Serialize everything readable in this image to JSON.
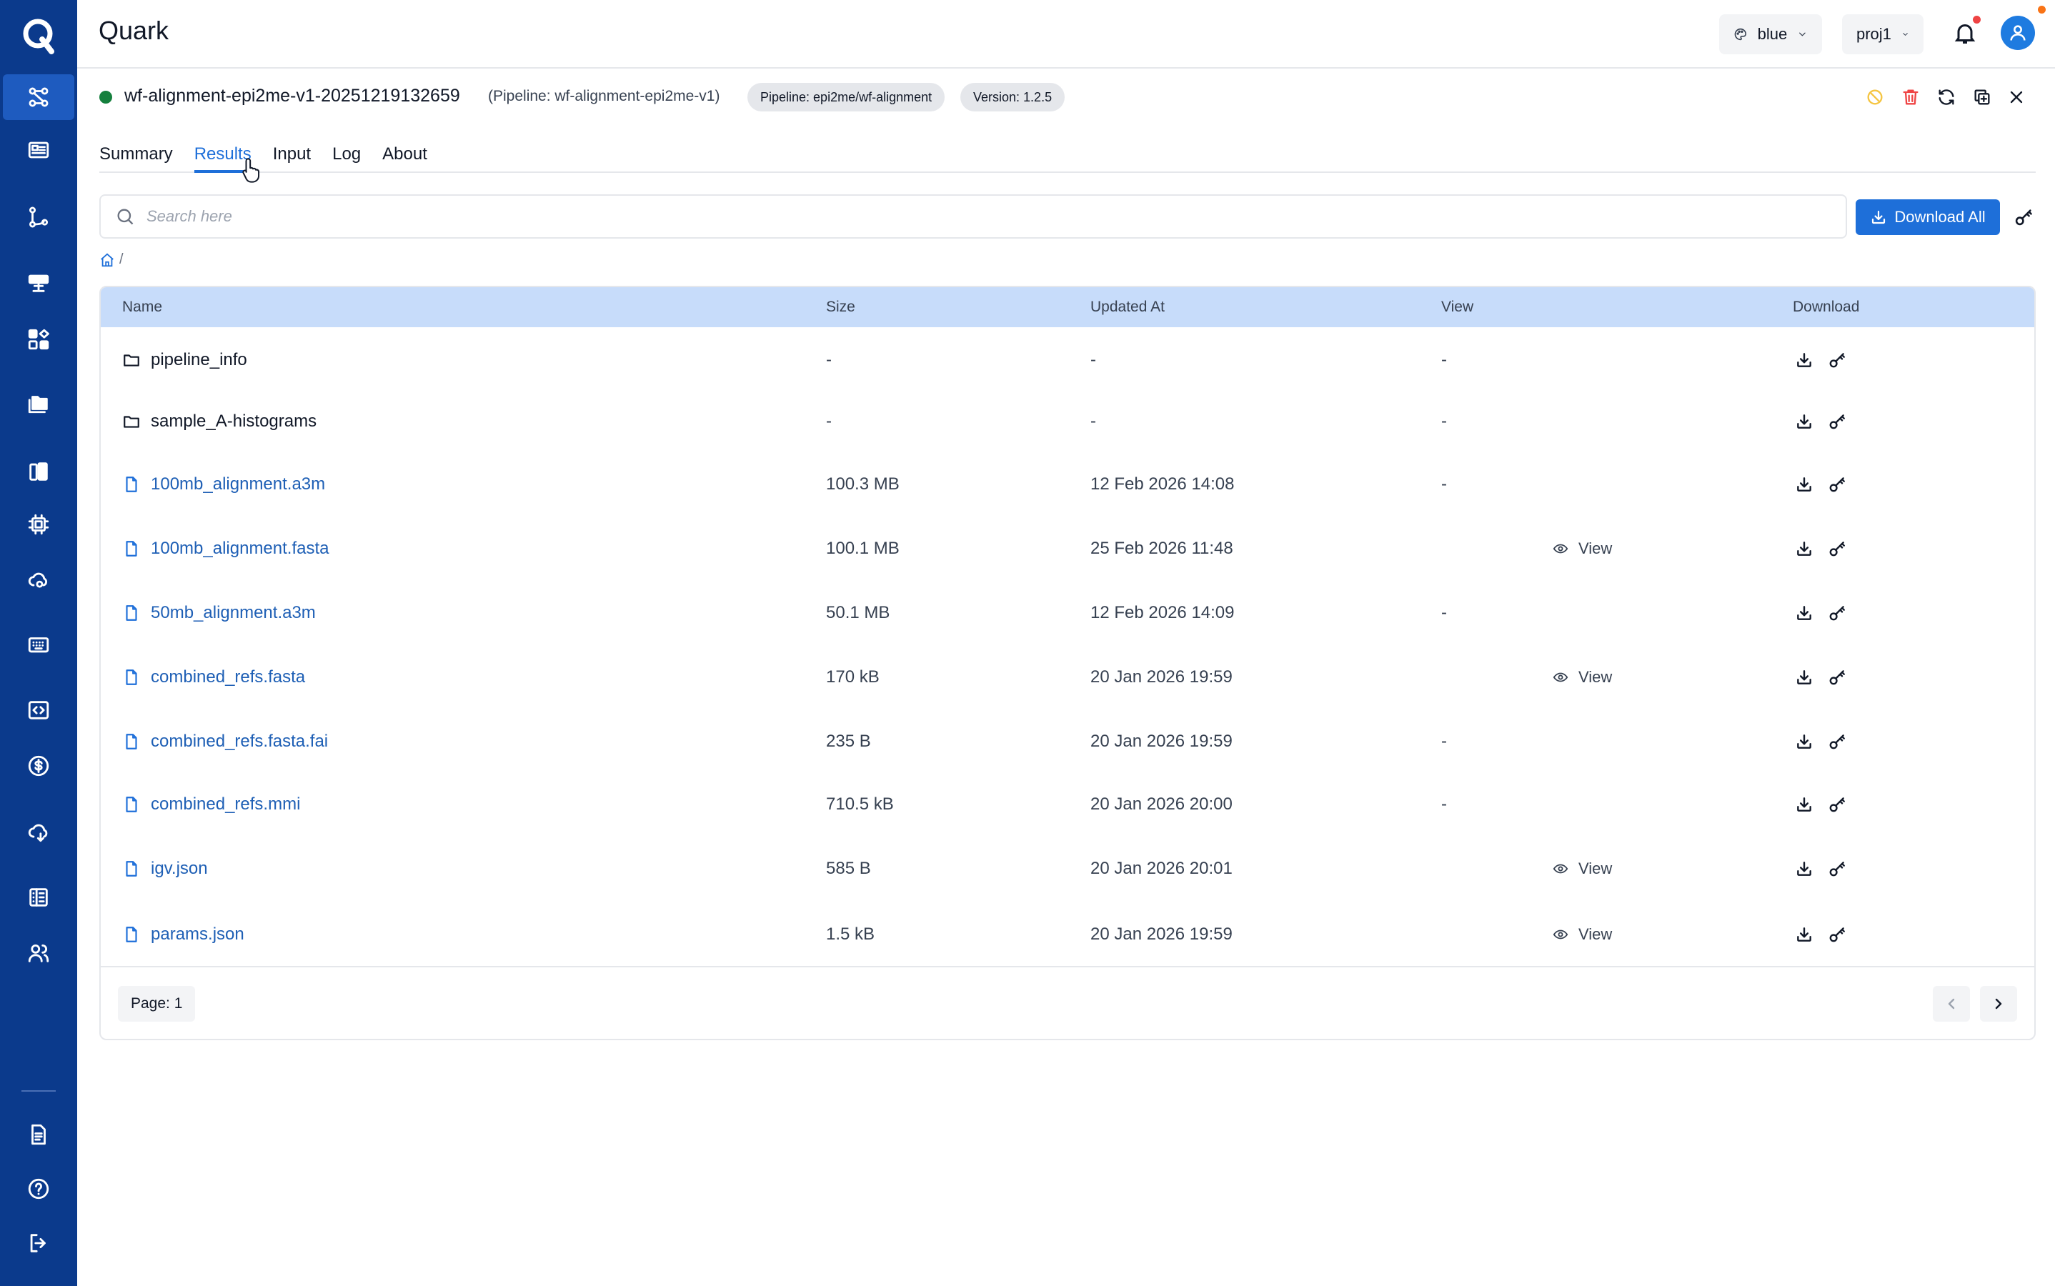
{
  "app": {
    "title": "Quark",
    "logo_letter": "Q"
  },
  "header": {
    "theme_label": "blue",
    "project_label": "proj1"
  },
  "colors": {
    "brand": "#0b3a8c",
    "accent": "#1e6fd9",
    "status_ok": "#15803d",
    "header_row": "#c7dcfa"
  },
  "sidebar": {
    "items": [
      {
        "icon": "workflow-icon"
      },
      {
        "icon": "id-card-icon"
      },
      {
        "icon": "pipeline-icon"
      },
      {
        "icon": "server-icon"
      },
      {
        "icon": "apps-icon"
      },
      {
        "icon": "folders-icon"
      },
      {
        "icon": "library-icon"
      },
      {
        "icon": "chip-icon"
      },
      {
        "icon": "cloud-settings-icon"
      },
      {
        "icon": "keyboard-icon"
      },
      {
        "icon": "code-icon"
      },
      {
        "icon": "billing-icon"
      },
      {
        "icon": "cloud-download-icon"
      },
      {
        "icon": "sheet-icon"
      },
      {
        "icon": "users-icon"
      },
      {
        "icon": "document-icon"
      },
      {
        "icon": "help-icon"
      },
      {
        "icon": "logout-icon"
      }
    ]
  },
  "run": {
    "name": "wf-alignment-epi2me-v1-20251219132659",
    "pipeline_paren": "(Pipeline: wf-alignment-epi2me-v1)",
    "pipeline_chip": "Pipeline: epi2me/wf-alignment",
    "version_chip": "Version: 1.2.5"
  },
  "tabs": [
    {
      "label": "Summary"
    },
    {
      "label": "Results"
    },
    {
      "label": "Input"
    },
    {
      "label": "Log"
    },
    {
      "label": "About"
    }
  ],
  "search": {
    "placeholder": "Search here",
    "value": ""
  },
  "download_all_label": "Download All",
  "breadcrumb": {
    "separator": "/"
  },
  "table": {
    "headers": {
      "name": "Name",
      "size": "Size",
      "updated": "Updated At",
      "view": "View",
      "download": "Download"
    },
    "rows": [
      {
        "type": "folder",
        "name": "pipeline_info",
        "size": "-",
        "updated": "-",
        "view": "-"
      },
      {
        "type": "folder",
        "name": "sample_A-histograms",
        "size": "-",
        "updated": "-",
        "view": "-"
      },
      {
        "type": "file",
        "name": "100mb_alignment.a3m",
        "size": "100.3 MB",
        "updated": "12 Feb 2026 14:08",
        "view": "-"
      },
      {
        "type": "file",
        "name": "100mb_alignment.fasta",
        "size": "100.1 MB",
        "updated": "25 Feb 2026 11:48",
        "view": "View"
      },
      {
        "type": "file",
        "name": "50mb_alignment.a3m",
        "size": "50.1 MB",
        "updated": "12 Feb 2026 14:09",
        "view": "-"
      },
      {
        "type": "file",
        "name": "combined_refs.fasta",
        "size": "170 kB",
        "updated": "20 Jan 2026 19:59",
        "view": "View"
      },
      {
        "type": "file",
        "name": "combined_refs.fasta.fai",
        "size": "235 B",
        "updated": "20 Jan 2026 19:59",
        "view": "-"
      },
      {
        "type": "file",
        "name": "combined_refs.mmi",
        "size": "710.5 kB",
        "updated": "20 Jan 2026 20:00",
        "view": "-"
      },
      {
        "type": "file",
        "name": "igv.json",
        "size": "585 B",
        "updated": "20 Jan 2026 20:01",
        "view": "View"
      },
      {
        "type": "file",
        "name": "params.json",
        "size": "1.5 kB",
        "updated": "20 Jan 2026 19:59",
        "view": "View"
      }
    ]
  },
  "pagination": {
    "label": "Page: 1"
  }
}
